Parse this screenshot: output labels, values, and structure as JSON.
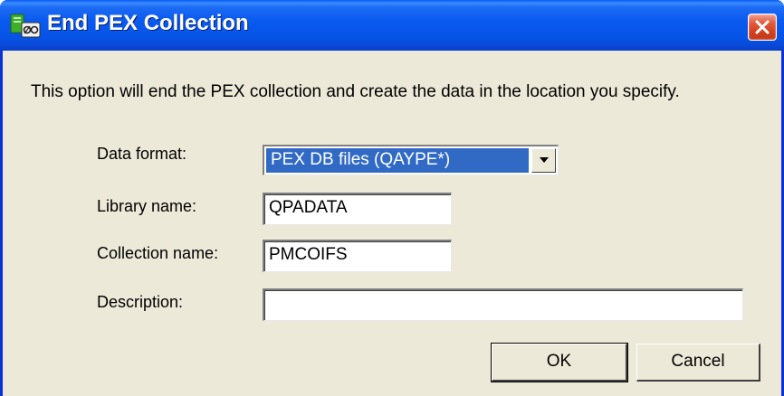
{
  "window": {
    "title": "End PEX Collection",
    "app_icon": "pex-collection-icon",
    "close_icon": "close-icon"
  },
  "dialog": {
    "description": "This option will end the PEX collection and create the data in the location you specify.",
    "fields": {
      "data_format": {
        "label": "Data format:",
        "value": "PEX DB files (QAYPE*)",
        "icon": "chevron-down-icon"
      },
      "library_name": {
        "label": "Library name:",
        "value": "QPADATA"
      },
      "collection_name": {
        "label": "Collection name:",
        "value": "PMCOIFS"
      },
      "description": {
        "label": "Description:",
        "value": ""
      }
    },
    "buttons": {
      "ok": "OK",
      "cancel": "Cancel"
    }
  },
  "colors": {
    "titlebar": "#0a5af0",
    "face": "#ece9d8",
    "selection": "#316ac5",
    "close": "#e2583a"
  }
}
